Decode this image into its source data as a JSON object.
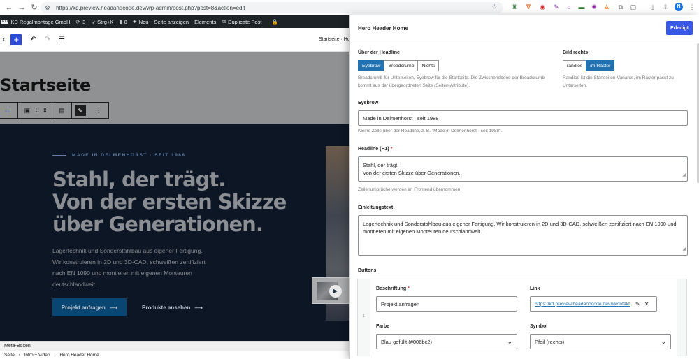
{
  "browser": {
    "url": "https://kd.preview.headandcode.dev/wp-admin/post.php?post=8&action=edit",
    "profile_initial": "N"
  },
  "adminbar": {
    "site_name": "KD Regalmontage GmbH",
    "updates_count": "3",
    "shortcut": "Strg+K",
    "comments_count": "0",
    "new_label": "Neu",
    "view_page": "Seite anzeigen",
    "elements": "Elements",
    "duplicate": "Duplicate Post"
  },
  "editor": {
    "breadcrumb_top": "Startseite · Ho",
    "page_title": "Startseite",
    "meta_boxes": "Meta-Boxen",
    "footer_crumb": [
      "Seite",
      "Intro + Video",
      "Hero Header Home"
    ]
  },
  "hero": {
    "eyebrow": "MADE IN DELMENHORST · SEIT 1988",
    "headline_lines": [
      "Stahl, der trägt.",
      "Von der ersten Skizze",
      "über Generationen."
    ],
    "intro": "Lagertechnik und Sonderstahlbau aus eigener Fertigung. Wir konstruieren in 2D und 3D-CAD, schweißen zertifiziert nach EN 1090 und montieren mit eigenen Monteuren deutschlandweit.",
    "cta_primary": "Projekt anfragen",
    "cta_secondary": "Produkte ansehen"
  },
  "panel": {
    "title": "Hero Header Home",
    "done": "Erledigt",
    "above_headline": {
      "label": "Über der Headline",
      "options": [
        "Eyebrow",
        "Breadcrumb",
        "Nichts"
      ],
      "selected": "Eyebrow",
      "help": "Breadcrumb für Unterseiten, Eyebrow für die Startseite. Die Zwischenebene der Breadcrumb kommt aus der übergeordneten Seite (Seiten-Attribute)."
    },
    "image_right": {
      "label": "Bild rechts",
      "options": [
        "randlos",
        "im Raster"
      ],
      "selected": "im Raster",
      "help": "Randlos ist die Startseiten-Variante, im Raster passt zu Unterseiten."
    },
    "eyebrow": {
      "label": "Eyebrow",
      "value": "Made in Delmenhorst · seit 1988",
      "help": "Kleine Zeile über der Headline, z. B. \"Made in Delmenhorst · seit 1988\"."
    },
    "headline": {
      "label": "Headline (H1)",
      "required": "*",
      "value_lines": [
        "Stahl, der trägt.",
        "Von der ersten Skizze über Generationen."
      ],
      "help": "Zeilenumbrüche werden im Frontend übernommen."
    },
    "intro": {
      "label": "Einleitungstext",
      "value": "Lagertechnik und Sonderstahlbau aus eigener Fertigung. Wir konstruieren in 2D und 3D-CAD, schweißen zertifiziert nach EN 1090 und montieren mit eigenen Monteuren deutschlandweit."
    },
    "buttons": {
      "label": "Buttons",
      "row_index": "1",
      "caption_label": "Beschriftung",
      "caption_required": "*",
      "caption_value": "Projekt anfragen",
      "link_label": "Link",
      "link_value": "https://kd.preview.headandcode.dev/#kontakt",
      "color_label": "Farbe",
      "color_value": "Blau gefüllt (#006bc2)",
      "symbol_label": "Symbol",
      "symbol_value": "Pfeil (rechts)"
    }
  },
  "colors": {
    "accent": "#3858e9",
    "toggle_active": "#2271b1",
    "adminbar": "#1d2327",
    "hero_bg": "#0c1624"
  }
}
